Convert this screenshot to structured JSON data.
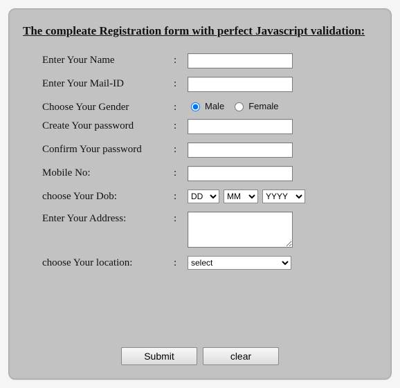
{
  "heading": "The compleate Registration form with perfect Javascript validation:",
  "labels": {
    "name": "Enter Your Name",
    "mail": "Enter Your Mail-ID",
    "gender": "Choose Your Gender",
    "password": "Create Your password",
    "confirm": "Confirm Your password",
    "mobile": "Mobile No:",
    "dob": "choose Your Dob:",
    "address": "Enter Your Address:",
    "location": "choose Your location:"
  },
  "colon": ":",
  "gender": {
    "male": "Male",
    "female": "Female",
    "selected": "male"
  },
  "dob": {
    "dd_placeholder": "DD",
    "mm_placeholder": "MM",
    "yyyy_placeholder": "YYYY"
  },
  "location": {
    "placeholder": "select"
  },
  "buttons": {
    "submit": "Submit",
    "clear": "clear"
  },
  "values": {
    "name": "",
    "mail": "",
    "password": "",
    "confirm": "",
    "mobile": "",
    "address": ""
  }
}
